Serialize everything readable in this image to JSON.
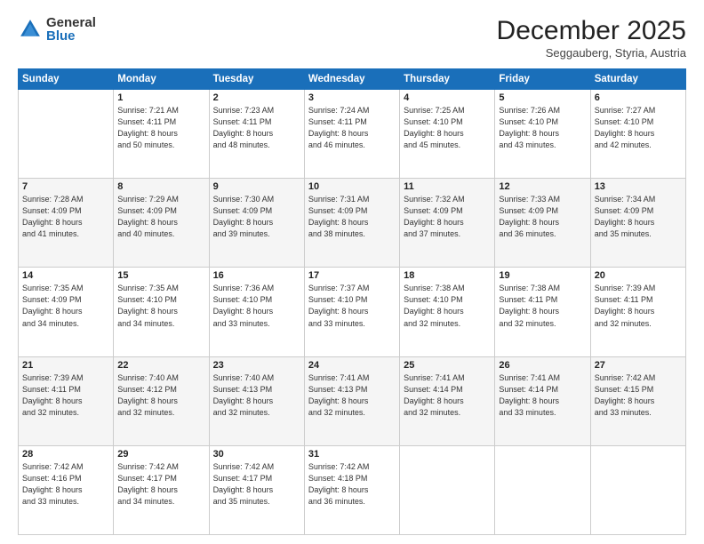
{
  "logo": {
    "general": "General",
    "blue": "Blue"
  },
  "header": {
    "month": "December 2025",
    "location": "Seggauberg, Styria, Austria"
  },
  "weekdays": [
    "Sunday",
    "Monday",
    "Tuesday",
    "Wednesday",
    "Thursday",
    "Friday",
    "Saturday"
  ],
  "weeks": [
    [
      {
        "day": "",
        "info": ""
      },
      {
        "day": "1",
        "info": "Sunrise: 7:21 AM\nSunset: 4:11 PM\nDaylight: 8 hours\nand 50 minutes."
      },
      {
        "day": "2",
        "info": "Sunrise: 7:23 AM\nSunset: 4:11 PM\nDaylight: 8 hours\nand 48 minutes."
      },
      {
        "day": "3",
        "info": "Sunrise: 7:24 AM\nSunset: 4:11 PM\nDaylight: 8 hours\nand 46 minutes."
      },
      {
        "day": "4",
        "info": "Sunrise: 7:25 AM\nSunset: 4:10 PM\nDaylight: 8 hours\nand 45 minutes."
      },
      {
        "day": "5",
        "info": "Sunrise: 7:26 AM\nSunset: 4:10 PM\nDaylight: 8 hours\nand 43 minutes."
      },
      {
        "day": "6",
        "info": "Sunrise: 7:27 AM\nSunset: 4:10 PM\nDaylight: 8 hours\nand 42 minutes."
      }
    ],
    [
      {
        "day": "7",
        "info": "Sunrise: 7:28 AM\nSunset: 4:09 PM\nDaylight: 8 hours\nand 41 minutes."
      },
      {
        "day": "8",
        "info": "Sunrise: 7:29 AM\nSunset: 4:09 PM\nDaylight: 8 hours\nand 40 minutes."
      },
      {
        "day": "9",
        "info": "Sunrise: 7:30 AM\nSunset: 4:09 PM\nDaylight: 8 hours\nand 39 minutes."
      },
      {
        "day": "10",
        "info": "Sunrise: 7:31 AM\nSunset: 4:09 PM\nDaylight: 8 hours\nand 38 minutes."
      },
      {
        "day": "11",
        "info": "Sunrise: 7:32 AM\nSunset: 4:09 PM\nDaylight: 8 hours\nand 37 minutes."
      },
      {
        "day": "12",
        "info": "Sunrise: 7:33 AM\nSunset: 4:09 PM\nDaylight: 8 hours\nand 36 minutes."
      },
      {
        "day": "13",
        "info": "Sunrise: 7:34 AM\nSunset: 4:09 PM\nDaylight: 8 hours\nand 35 minutes."
      }
    ],
    [
      {
        "day": "14",
        "info": "Sunrise: 7:35 AM\nSunset: 4:09 PM\nDaylight: 8 hours\nand 34 minutes."
      },
      {
        "day": "15",
        "info": "Sunrise: 7:35 AM\nSunset: 4:10 PM\nDaylight: 8 hours\nand 34 minutes."
      },
      {
        "day": "16",
        "info": "Sunrise: 7:36 AM\nSunset: 4:10 PM\nDaylight: 8 hours\nand 33 minutes."
      },
      {
        "day": "17",
        "info": "Sunrise: 7:37 AM\nSunset: 4:10 PM\nDaylight: 8 hours\nand 33 minutes."
      },
      {
        "day": "18",
        "info": "Sunrise: 7:38 AM\nSunset: 4:10 PM\nDaylight: 8 hours\nand 32 minutes."
      },
      {
        "day": "19",
        "info": "Sunrise: 7:38 AM\nSunset: 4:11 PM\nDaylight: 8 hours\nand 32 minutes."
      },
      {
        "day": "20",
        "info": "Sunrise: 7:39 AM\nSunset: 4:11 PM\nDaylight: 8 hours\nand 32 minutes."
      }
    ],
    [
      {
        "day": "21",
        "info": "Sunrise: 7:39 AM\nSunset: 4:11 PM\nDaylight: 8 hours\nand 32 minutes."
      },
      {
        "day": "22",
        "info": "Sunrise: 7:40 AM\nSunset: 4:12 PM\nDaylight: 8 hours\nand 32 minutes."
      },
      {
        "day": "23",
        "info": "Sunrise: 7:40 AM\nSunset: 4:13 PM\nDaylight: 8 hours\nand 32 minutes."
      },
      {
        "day": "24",
        "info": "Sunrise: 7:41 AM\nSunset: 4:13 PM\nDaylight: 8 hours\nand 32 minutes."
      },
      {
        "day": "25",
        "info": "Sunrise: 7:41 AM\nSunset: 4:14 PM\nDaylight: 8 hours\nand 32 minutes."
      },
      {
        "day": "26",
        "info": "Sunrise: 7:41 AM\nSunset: 4:14 PM\nDaylight: 8 hours\nand 33 minutes."
      },
      {
        "day": "27",
        "info": "Sunrise: 7:42 AM\nSunset: 4:15 PM\nDaylight: 8 hours\nand 33 minutes."
      }
    ],
    [
      {
        "day": "28",
        "info": "Sunrise: 7:42 AM\nSunset: 4:16 PM\nDaylight: 8 hours\nand 33 minutes."
      },
      {
        "day": "29",
        "info": "Sunrise: 7:42 AM\nSunset: 4:17 PM\nDaylight: 8 hours\nand 34 minutes."
      },
      {
        "day": "30",
        "info": "Sunrise: 7:42 AM\nSunset: 4:17 PM\nDaylight: 8 hours\nand 35 minutes."
      },
      {
        "day": "31",
        "info": "Sunrise: 7:42 AM\nSunset: 4:18 PM\nDaylight: 8 hours\nand 36 minutes."
      },
      {
        "day": "",
        "info": ""
      },
      {
        "day": "",
        "info": ""
      },
      {
        "day": "",
        "info": ""
      }
    ]
  ]
}
